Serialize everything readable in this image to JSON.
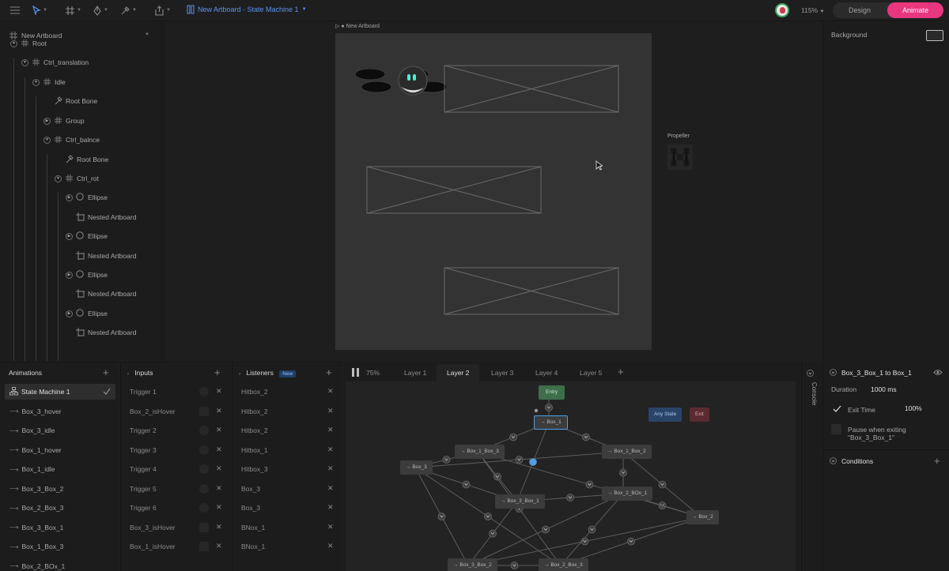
{
  "toolbar": {
    "file_title": "New Artboard - State Machine 1",
    "zoom": "115%",
    "design_label": "Design",
    "animate_label": "Animate"
  },
  "hierarchy": {
    "artboard": "New Artboard",
    "items": [
      {
        "label": "Root",
        "icon": "group-icon"
      },
      {
        "label": "Ctrl_translation",
        "icon": "group-icon"
      },
      {
        "label": "Idle",
        "icon": "group-icon"
      },
      {
        "label": "Root Bone",
        "icon": "bone-icon"
      },
      {
        "label": "Group",
        "icon": "group-icon"
      },
      {
        "label": "Ctrl_balnce",
        "icon": "group-icon"
      },
      {
        "label": "Root Bone",
        "icon": "bone-icon"
      },
      {
        "label": "Ctrl_rot",
        "icon": "group-icon"
      },
      {
        "label": "Ellipse",
        "icon": "ellipse-icon"
      },
      {
        "label": "Nested Artboard",
        "icon": "nested-artboard-icon"
      },
      {
        "label": "Ellipse",
        "icon": "ellipse-icon"
      },
      {
        "label": "Nested Artboard",
        "icon": "nested-artboard-icon"
      },
      {
        "label": "Ellipse",
        "icon": "ellipse-icon"
      },
      {
        "label": "Nested Artboard",
        "icon": "nested-artboard-icon"
      },
      {
        "label": "Ellipse",
        "icon": "ellipse-icon"
      },
      {
        "label": "Nested Artboard",
        "icon": "nested-artboard-icon"
      }
    ]
  },
  "canvas": {
    "artboard_label": "New Artboard",
    "propeller_label": "Propeller"
  },
  "inspector": {
    "background_label": "Background"
  },
  "animations": {
    "title": "Animations",
    "items": [
      "State Machine 1",
      "Box_3_hover",
      "Box_3_idle",
      "Box_1_hover",
      "Box_1_idle",
      "Box_3_Box_2",
      "Box_2_Box_3",
      "Box_3_Box_1",
      "Box_1_Box_3",
      "Box_2_BOx_1"
    ]
  },
  "inputs": {
    "title": "Inputs",
    "items": [
      {
        "label": "Trigger 1",
        "kind": "trigger"
      },
      {
        "label": "Box_2_isHover",
        "kind": "boolean"
      },
      {
        "label": "Trigger 2",
        "kind": "trigger"
      },
      {
        "label": "Trigger 3",
        "kind": "trigger"
      },
      {
        "label": "Trigger 4",
        "kind": "trigger"
      },
      {
        "label": "Trigger 5",
        "kind": "trigger"
      },
      {
        "label": "Trigger 6",
        "kind": "trigger"
      },
      {
        "label": "Box_3_isHover",
        "kind": "boolean"
      },
      {
        "label": "Box_1_isHover",
        "kind": "boolean"
      }
    ]
  },
  "listeners": {
    "title": "Listeners",
    "badge": "New",
    "items": [
      "Hitbox_2",
      "Hitbox_2",
      "Hitbox_2",
      "Hitbox_1",
      "Hitbox_3",
      "Box_3",
      "Box_3",
      "BNox_1",
      "BNox_1"
    ]
  },
  "state_machine": {
    "zoom": "75%",
    "layers": [
      "Layer 1",
      "Layer 2",
      "Layer 3",
      "Layer 4",
      "Layer 5"
    ],
    "active_layer": "Layer 2",
    "nodes": {
      "entry": "Entry",
      "any_state": "Any State",
      "exit": "Exit",
      "box_1": "Box_1",
      "box_1_box_3": "Box_1_Box_3",
      "box_1_box_2": "Box_1_Box_2",
      "box_3": "Box_3",
      "box_3_box_1": "Box_3_Box_1",
      "box_2_box_1": "Box_2_BOx_1",
      "box_2": "Box_2",
      "box_3_box_2": "Box_3_Box_2",
      "box_2_box_3": "Box_2_Box_3"
    }
  },
  "console": {
    "label": "Console"
  },
  "transition": {
    "title": "Box_3_Box_1 to Box_1",
    "duration_label": "Duration",
    "duration_value": "1000 ms",
    "exit_time_label": "Exit Time",
    "exit_time_value": "100%",
    "pause_label_1": "Pause when exiting",
    "pause_label_2": "\"Box_3_Box_1\"",
    "conditions_label": "Conditions"
  }
}
